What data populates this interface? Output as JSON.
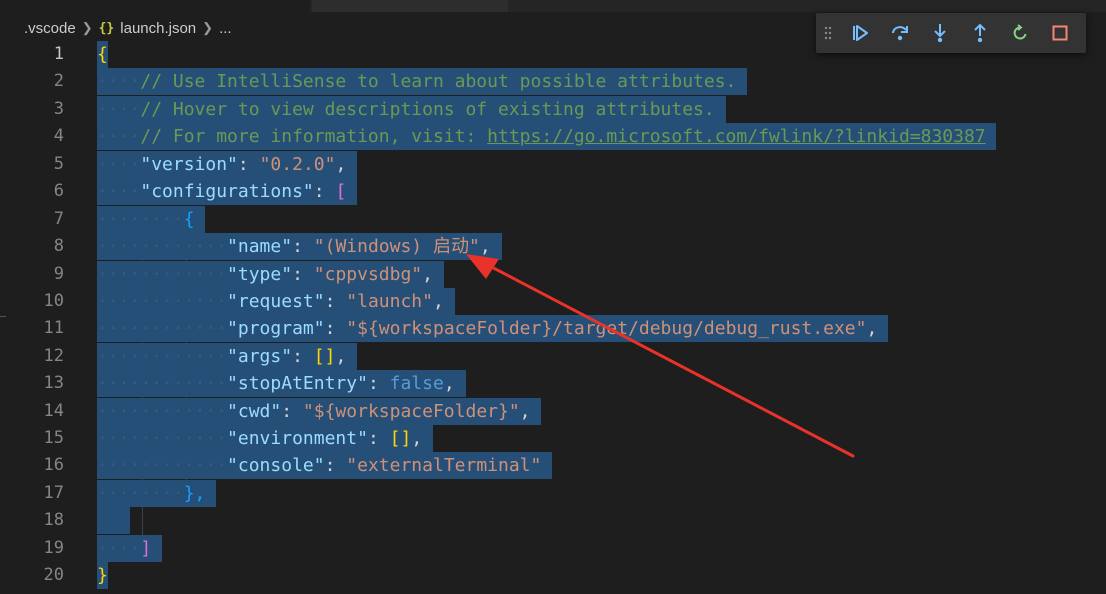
{
  "breadcrumb": {
    "folder": ".vscode",
    "file": "launch.json",
    "ellipsis": "...",
    "file_icon": "{}"
  },
  "debug_toolbar": {
    "buttons": [
      "gripper-icon",
      "continue-icon",
      "step-over-icon",
      "step-into-icon",
      "step-out-icon",
      "restart-icon",
      "stop-icon"
    ],
    "colors": {
      "blue": "#75beff",
      "green": "#89d185",
      "red": "#f48771"
    }
  },
  "editor": {
    "line_numbers": [
      "1",
      "2",
      "3",
      "4",
      "5",
      "6",
      "7",
      "8",
      "9",
      "10",
      "11",
      "12",
      "13",
      "14",
      "15",
      "16",
      "17",
      "18",
      "19",
      "20"
    ],
    "selection_color": "#264f78",
    "l1_brace": "{",
    "l2_comment": "// Use IntelliSense to learn about possible attributes.",
    "l3_comment": "// Hover to view descriptions of existing attributes.",
    "l4_comment_prefix": "// For more information, visit: ",
    "l4_link": "https://go.microsoft.com/fwlink/?linkid=830387",
    "l5_key": "\"version\"",
    "l5_value": "\"0.2.0\"",
    "l6_key": "\"configurations\"",
    "l6_bracket": "[",
    "l7_brace": "{",
    "l8_key": "\"name\"",
    "l8_value": "\"(Windows) 启动\"",
    "l9_key": "\"type\"",
    "l9_value": "\"cppvsdbg\"",
    "l10_key": "\"request\"",
    "l10_value": "\"launch\"",
    "l11_key": "\"program\"",
    "l11_value": "\"${workspaceFolder}/target/debug/debug_rust.exe\"",
    "l12_key": "\"args\"",
    "l12_value": "[]",
    "l13_key": "\"stopAtEntry\"",
    "l13_value": "false",
    "l14_key": "\"cwd\"",
    "l14_value": "\"${workspaceFolder}\"",
    "l15_key": "\"environment\"",
    "l15_value": "[]",
    "l16_key": "\"console\"",
    "l16_value": "\"externalTerminal\"",
    "l17_close": "},",
    "l19_bracket": "]",
    "l20_brace": "}"
  },
  "annotation_arrow_color": "#e8322a"
}
